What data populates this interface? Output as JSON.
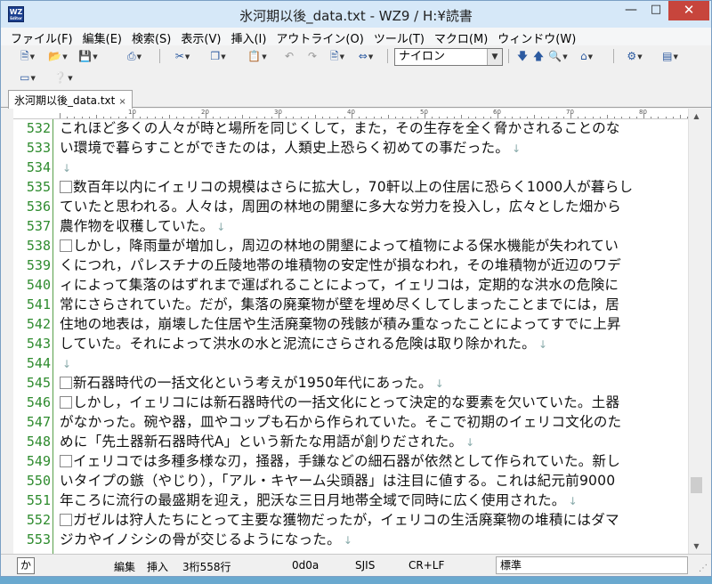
{
  "window": {
    "title": "氷河期以後_data.txt - WZ9 / H:¥読書",
    "app_icon_label": "WZ",
    "app_icon_sub": "Editor"
  },
  "menu": [
    "ファイル(F)",
    "編集(E)",
    "検索(S)",
    "表示(V)",
    "挿入(I)",
    "アウトライン(O)",
    "ツール(T)",
    "マクロ(M)",
    "ウィンドウ(W)"
  ],
  "toolbar": {
    "font_name": "ナイロン"
  },
  "tab": {
    "label": "氷河期以後_data.txt",
    "close": "×"
  },
  "ruler": {
    "numbers": [
      "10",
      "20",
      "30",
      "40",
      "50",
      "60",
      "70",
      "80"
    ]
  },
  "lines": [
    {
      "n": "532",
      "box": false,
      "text": "これほど多くの人々が時と場所を同じくして，また，その生存を全く脅かされることのな",
      "nl": false
    },
    {
      "n": "533",
      "box": false,
      "text": "い環境で暮らすことができたのは，人類史上恐らく初めての事だった。",
      "nl": true
    },
    {
      "n": "534",
      "box": false,
      "text": "",
      "nl": true
    },
    {
      "n": "535",
      "box": true,
      "text": "数百年以内にイェリコの規模はさらに拡大し，70軒以上の住居に恐らく1000人が暮らし",
      "nl": false
    },
    {
      "n": "536",
      "box": false,
      "text": "ていたと思われる。人々は，周囲の林地の開墾に多大な労力を投入し，広々とした畑から",
      "nl": false
    },
    {
      "n": "537",
      "box": false,
      "text": "農作物を収穫していた。",
      "nl": true
    },
    {
      "n": "538",
      "box": true,
      "text": "しかし，降雨量が増加し，周辺の林地の開墾によって植物による保水機能が失われてい",
      "nl": false
    },
    {
      "n": "539",
      "box": false,
      "text": "くにつれ，パレスチナの丘陵地帯の堆積物の安定性が損なわれ，その堆積物が近辺のワデ",
      "nl": false
    },
    {
      "n": "540",
      "box": false,
      "text": "ィによって集落のはずれまで運ばれることによって，イェリコは，定期的な洪水の危険に",
      "nl": false
    },
    {
      "n": "541",
      "box": false,
      "text": "常にさらされていた。だが，集落の廃棄物が壁を埋め尽くしてしまったことまでには，居",
      "nl": false
    },
    {
      "n": "542",
      "box": false,
      "text": "住地の地表は，崩壊した住居や生活廃棄物の残骸が積み重なったことによってすでに上昇",
      "nl": false
    },
    {
      "n": "543",
      "box": false,
      "text": "していた。それによって洪水の水と泥流にさらされる危険は取り除かれた。",
      "nl": true
    },
    {
      "n": "544",
      "box": false,
      "text": "",
      "nl": true
    },
    {
      "n": "545",
      "box": true,
      "text": "新石器時代の一括文化という考えが1950年代にあった。",
      "nl": true
    },
    {
      "n": "546",
      "box": true,
      "text": "しかし，イェリコには新石器時代の一括文化にとって決定的な要素を欠いていた。土器",
      "nl": false
    },
    {
      "n": "547",
      "box": false,
      "text": "がなかった。碗や器，皿やコップも石から作られていた。そこで初期のイェリコ文化のた",
      "nl": false
    },
    {
      "n": "548",
      "box": false,
      "text": "めに「先土器新石器時代A」という新たな用語が創りだされた。",
      "nl": true
    },
    {
      "n": "549",
      "box": true,
      "text": "イェリコでは多種多様な刃，掻器，手鎌などの細石器が依然として作られていた。新し",
      "nl": false
    },
    {
      "n": "550",
      "box": false,
      "text": "いタイプの鏃（やじり），「アル・キヤーム尖頭器」は注目に値する。これは紀元前9000",
      "nl": false
    },
    {
      "n": "551",
      "box": false,
      "text": "年ころに流行の最盛期を迎え，肥沃な三日月地帯全域で同時に広く使用された。",
      "nl": true
    },
    {
      "n": "552",
      "box": true,
      "text": "ガゼルは狩人たちにとって主要な獲物だったが，イェリコの生活廃棄物の堆積にはダマ",
      "nl": false
    },
    {
      "n": "553",
      "box": false,
      "text": "ジカやイノシシの骨が交じるようになった。",
      "nl": true
    }
  ],
  "newline_mark": "↓",
  "status": {
    "ime": "か",
    "mode_edit": "編集",
    "mode_insert": "挿入",
    "position": "3桁558行",
    "char_code": "0d0a",
    "encoding": "SJIS",
    "line_ending": "CR+LF",
    "style": "標準"
  },
  "colors": {
    "line_number": "#2e8b2e",
    "gutter_line": "#58a04a",
    "close_button": "#c7453c",
    "title_bar": "#d6e8f8"
  }
}
